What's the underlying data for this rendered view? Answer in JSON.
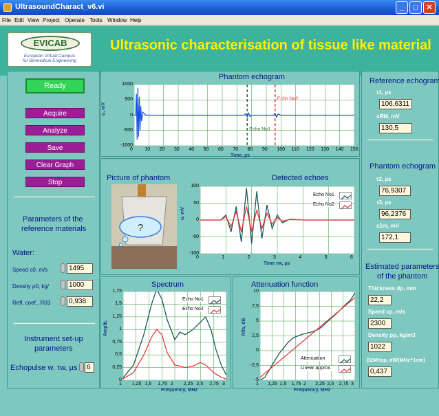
{
  "window": {
    "title": "UltrasoundCharact_v6.vi"
  },
  "menu": [
    "File",
    "Edit",
    "View",
    "Project",
    "Operate",
    "Tools",
    "Window",
    "Help"
  ],
  "logo": {
    "name": "EVICAB",
    "subtitle1": "European Virtual Campus",
    "subtitle2": "for Biomedical Engineering"
  },
  "banner": "Ultrasonic characterisation of tissue like material",
  "controls": {
    "status": "Ready",
    "acquire": "Acquire",
    "analyze": "Analyze",
    "save": "Save",
    "clear": "Clear Graph",
    "stop": "Stop"
  },
  "reference": {
    "title1": "Parameters of the",
    "title2": "reference materials",
    "water": "Water:",
    "speed_label": "Speed c0, m/s",
    "speed": "1495",
    "density_label": "Density ρ0, kg/",
    "density": "1000",
    "refl_label": "Refl. coef., R03",
    "refl": "0,938"
  },
  "instrument": {
    "title1": "Instrument set-up",
    "title2": "parameters",
    "pulse_label": "Echopulse w. τw, µs",
    "pulse": "6"
  },
  "right": {
    "ref_title": "Reference echogram",
    "t1_label": "τ1, µs",
    "t1": "106,6311",
    "srm_label": "sRM, mV",
    "srm": "130,5",
    "ph_title": "Phantom echogram",
    "t2_label": "τ2, µs",
    "t2": "76,9307",
    "t3_label": "τ3, µs",
    "t3": "96,2376",
    "s1m_label": "s1m, mV",
    "s1m": "172,1",
    "est_title1": "Estimated parameters",
    "est_title2": "of the phantom",
    "dp_label": "Thickness dp, mm",
    "dp": "22,2",
    "cp_label": "Speed cp, m/s",
    "cp": "2300",
    "rhop_label": "Density ρp, kg/m3",
    "rhop": "1022",
    "beta_label": "β2MHzp, dB/(MHz^1cm)",
    "beta": "0,437"
  },
  "photo": {
    "title": "Picture of phantom",
    "bubble": "?"
  },
  "chart_data": [
    {
      "type": "line",
      "title": "Phantom echogram",
      "xlabel": "Time, µs",
      "ylabel": "u, mV",
      "xlim": [
        0,
        150
      ],
      "ylim": [
        -1000,
        1000
      ],
      "xticks": [
        0,
        10,
        20,
        30,
        40,
        50,
        60,
        70,
        80,
        90,
        100,
        110,
        120,
        130,
        140,
        150
      ],
      "yticks": [
        1000,
        500,
        0,
        -500,
        -1000
      ],
      "markers": [
        {
          "name": "Echo No1",
          "x": 77
        },
        {
          "name": "Echo No2",
          "x": 96
        }
      ],
      "series": [
        {
          "x": [
            0,
            1,
            1.5,
            2,
            2.5,
            3,
            3.5,
            4,
            4.5,
            5,
            6,
            8,
            10,
            20,
            40,
            60,
            75,
            76,
            77,
            78,
            79,
            80,
            90,
            95,
            96,
            97,
            98,
            100,
            120,
            150
          ],
          "y": [
            0,
            0,
            700,
            -800,
            900,
            -700,
            600,
            -500,
            300,
            -200,
            100,
            0,
            0,
            0,
            0,
            0,
            0,
            50,
            -60,
            70,
            -50,
            0,
            0,
            0,
            60,
            -70,
            40,
            0,
            0,
            0
          ]
        }
      ]
    },
    {
      "type": "line",
      "title": "Detected echoes",
      "xlabel": "Time τw, µs",
      "ylabel": "u, mV",
      "xlim": [
        0,
        6
      ],
      "ylim": [
        -100,
        100
      ],
      "xticks": [
        0,
        1,
        2,
        3,
        4,
        5,
        6
      ],
      "yticks": [
        100,
        50,
        0,
        -50,
        -100
      ],
      "legend": [
        "Echo No1",
        "Echo No2"
      ],
      "series": [
        {
          "name": "Echo No1",
          "x": [
            0,
            0.8,
            1,
            1.2,
            1.4,
            1.6,
            1.8,
            2,
            2.2,
            2.4,
            2.6,
            2.8,
            3,
            3.2,
            3.5,
            4,
            5,
            6
          ],
          "y": [
            0,
            0,
            15,
            -35,
            40,
            -65,
            95,
            -70,
            85,
            -55,
            45,
            -25,
            15,
            -8,
            3,
            0,
            0,
            0
          ]
        },
        {
          "name": "Echo No2",
          "x": [
            0,
            0.8,
            1,
            1.2,
            1.4,
            1.6,
            1.8,
            2,
            2.2,
            2.4,
            2.6,
            2.8,
            3,
            3.2,
            3.5,
            4,
            5,
            6
          ],
          "y": [
            0,
            0,
            10,
            -20,
            25,
            -35,
            40,
            -35,
            30,
            -25,
            20,
            -12,
            8,
            -4,
            2,
            0,
            0,
            0
          ]
        }
      ]
    },
    {
      "type": "line",
      "title": "Spectrum",
      "xlabel": "Frequency, MHz",
      "ylabel": "Amplit.",
      "xlim": [
        1,
        3
      ],
      "ylim": [
        0,
        1.75
      ],
      "xticks": [
        1,
        1.25,
        1.5,
        1.75,
        2,
        2.25,
        2.5,
        2.75,
        3
      ],
      "yticks": [
        1.75,
        1.5,
        1.25,
        1,
        0.75,
        0.5,
        0.25,
        0
      ],
      "legend": [
        "Echo No1",
        "Echo No2"
      ],
      "series": [
        {
          "name": "Echo No1",
          "x": [
            1,
            1.2,
            1.4,
            1.55,
            1.65,
            1.75,
            1.85,
            2,
            2.1,
            2.2,
            2.35,
            2.5,
            2.6,
            2.7,
            2.8,
            2.9,
            3
          ],
          "y": [
            0.05,
            0.3,
            0.9,
            1.5,
            1.8,
            1.6,
            1.2,
            0.8,
            0.95,
            0.9,
            1,
            1.15,
            1.25,
            1,
            0.6,
            0.3,
            0.1
          ]
        },
        {
          "name": "Echo No2",
          "x": [
            1,
            1.2,
            1.4,
            1.55,
            1.65,
            1.75,
            1.85,
            2,
            2.1,
            2.2,
            2.35,
            2.5,
            2.6,
            2.7,
            2.8,
            2.9,
            3
          ],
          "y": [
            0.03,
            0.15,
            0.5,
            0.85,
            1,
            0.9,
            0.55,
            0.3,
            0.28,
            0.25,
            0.28,
            0.35,
            0.3,
            0.2,
            0.12,
            0.06,
            0.02
          ]
        }
      ]
    },
    {
      "type": "line",
      "title": "Attenuation function",
      "xlabel": "Frequency, MHz",
      "ylabel": "Alfa, dB",
      "xlim": [
        1,
        3
      ],
      "ylim": [
        -5,
        10
      ],
      "xticks": [
        1,
        1.25,
        1.5,
        1.75,
        2,
        2.25,
        2.5,
        2.75,
        3
      ],
      "yticks": [
        10,
        7.5,
        5,
        2.5,
        0,
        -2.5,
        -5
      ],
      "legend": [
        "Attenuation",
        "Linear approx."
      ],
      "series": [
        {
          "name": "Attenuation",
          "x": [
            1,
            1.1,
            1.2,
            1.3,
            1.4,
            1.5,
            1.6,
            1.7,
            1.8,
            1.9,
            2,
            2.1,
            2.2,
            2.3,
            2.4,
            2.5,
            2.6,
            2.7,
            2.8,
            2.9,
            3
          ],
          "y": [
            -5,
            -4.5,
            -3.2,
            -1.8,
            -0.5,
            0.5,
            1.5,
            2.2,
            2.5,
            2.8,
            3,
            3.2,
            3.5,
            4,
            4.8,
            5.5,
            6.2,
            7,
            7.8,
            8.5,
            9.8
          ]
        },
        {
          "name": "Linear approx.",
          "x": [
            1,
            3
          ],
          "y": [
            -4.5,
            9
          ]
        }
      ]
    }
  ]
}
